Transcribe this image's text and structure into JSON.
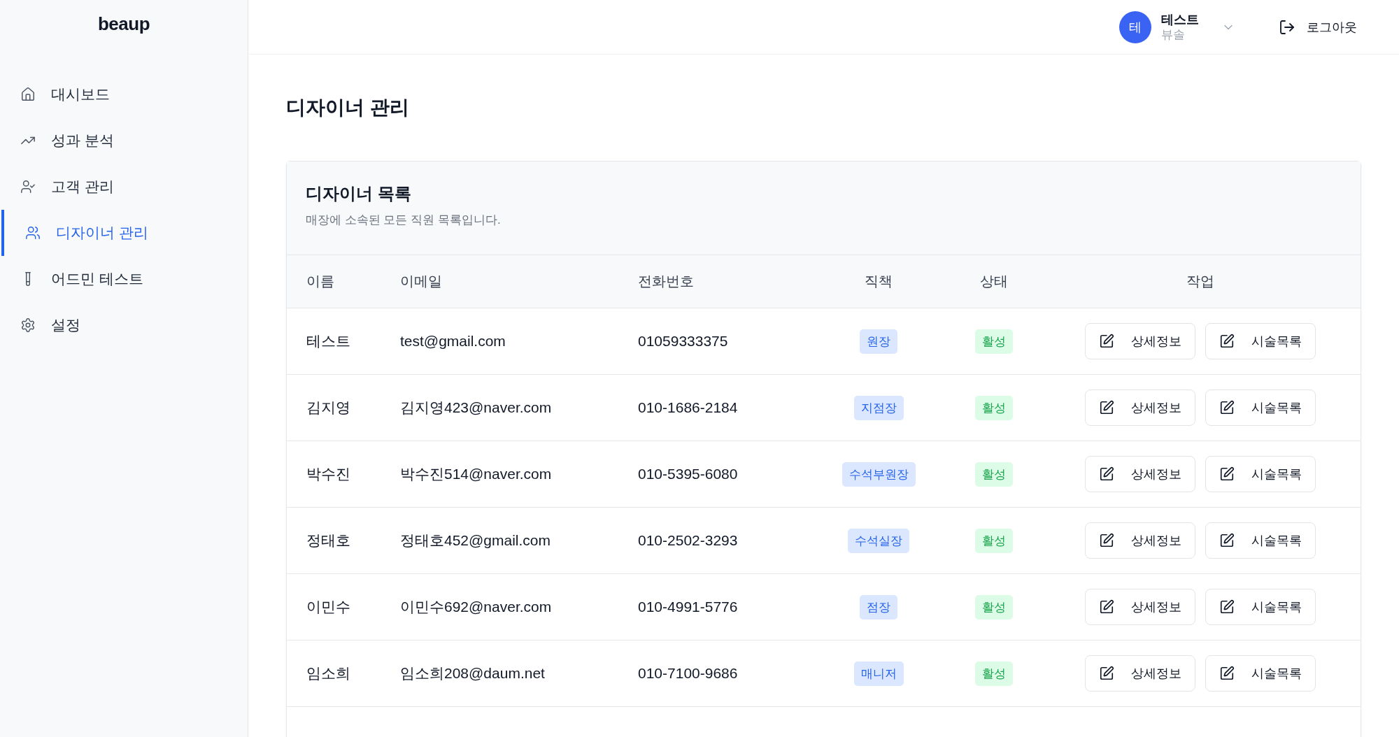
{
  "sidebar": {
    "logo": "beaup",
    "items": [
      {
        "label": "대시보드",
        "selected": false
      },
      {
        "label": "성과 분석",
        "selected": false
      },
      {
        "label": "고객 관리",
        "selected": false
      },
      {
        "label": "디자이너 관리",
        "selected": true
      },
      {
        "label": "어드민 테스트",
        "selected": false
      },
      {
        "label": "설정",
        "selected": false
      }
    ]
  },
  "header": {
    "user": {
      "initial": "테",
      "name": "테스트",
      "store": "뷰솔"
    },
    "logout": "로그아웃"
  },
  "page_title": "디자이너 관리",
  "card": {
    "title": "디자이너 목록",
    "subtitle": "매장에 소속된 모든 직원 목록입니다.",
    "columns": [
      "이름",
      "이메일",
      "전화번호",
      "직책",
      "상태",
      "작업"
    ],
    "rows": [
      {
        "name": "테스트",
        "email": "test@gmail.com",
        "phone": "01059333375",
        "role": "원장",
        "status": "활성",
        "actions": [
          "상세정보",
          "시술목록"
        ]
      },
      {
        "name": "김지영",
        "email": "김지영423@naver.com",
        "phone": "010-1686-2184",
        "role": "지점장",
        "status": "활성",
        "actions": [
          "상세정보",
          "시술목록"
        ]
      },
      {
        "name": "박수진",
        "email": "박수진514@naver.com",
        "phone": "010-5395-6080",
        "role": "수석부원장",
        "status": "활성",
        "actions": [
          "상세정보",
          "시술목록"
        ]
      },
      {
        "name": "정태호",
        "email": "정태호452@gmail.com",
        "phone": "010-2502-3293",
        "role": "수석실장",
        "status": "활성",
        "actions": [
          "상세정보",
          "시술목록"
        ]
      },
      {
        "name": "이민수",
        "email": "이민수692@naver.com",
        "phone": "010-4991-5776",
        "role": "점장",
        "status": "활성",
        "actions": [
          "상세정보",
          "시술목록"
        ]
      },
      {
        "name": "임소희",
        "email": "임소희208@daum.net",
        "phone": "010-7100-9686",
        "role": "매니저",
        "status": "활성",
        "actions": [
          "상세정보",
          "시술목록"
        ]
      }
    ]
  }
}
